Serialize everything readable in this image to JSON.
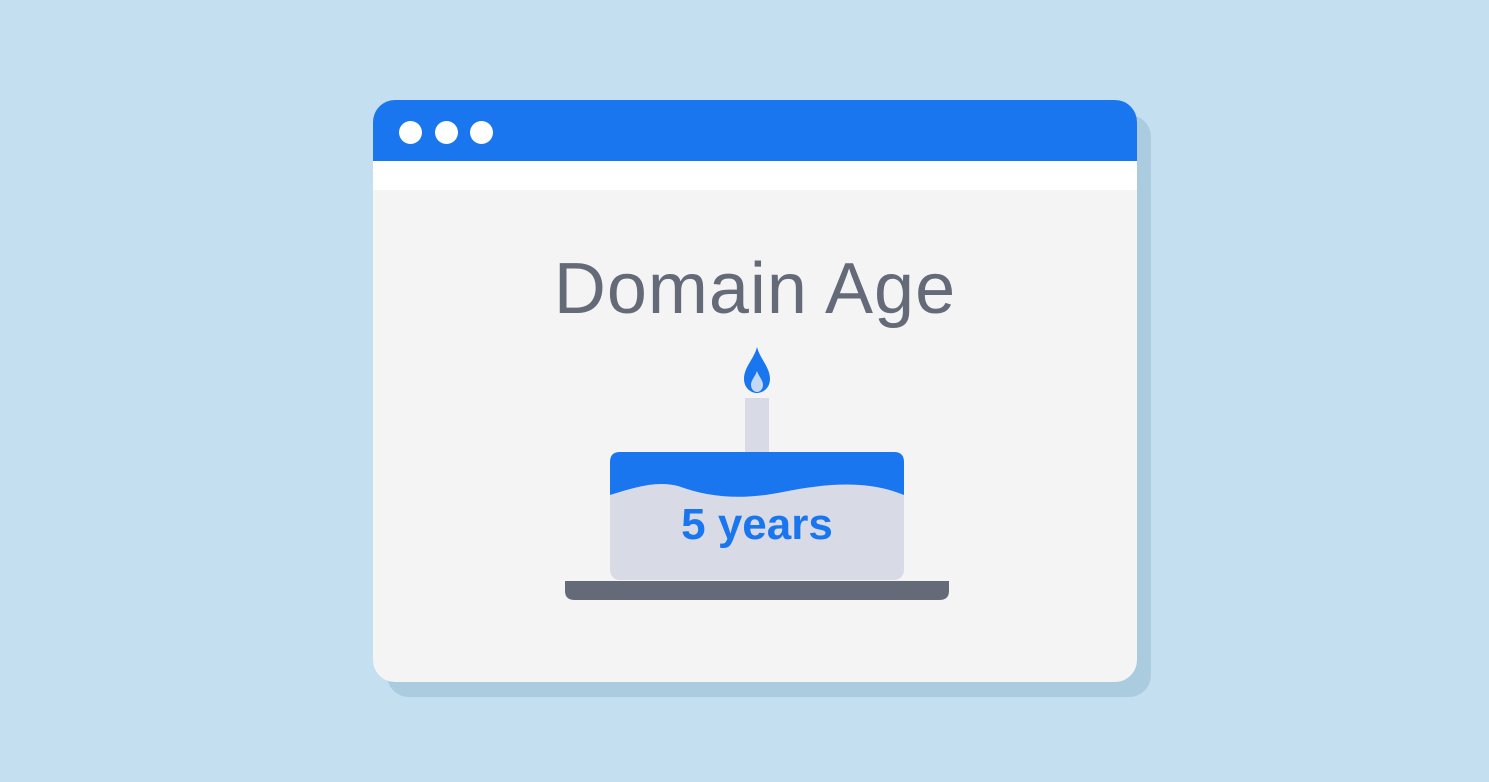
{
  "window": {
    "title": "Domain Age",
    "controls": [
      "dot",
      "dot",
      "dot"
    ]
  },
  "cake": {
    "label": "5 years",
    "icons": [
      "flame-icon",
      "candle-icon",
      "cake-icon",
      "cake-plate-icon"
    ]
  },
  "colors": {
    "background": "#c3dff0",
    "window_body": "#f4f4f5",
    "accent": "#1a76ef",
    "title_text": "#656a78",
    "cake_body": "#d8dbe5",
    "plate": "#656a78"
  }
}
